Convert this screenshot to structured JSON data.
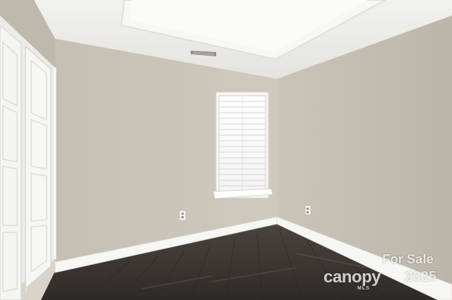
{
  "watermark": {
    "line1": "For Sale",
    "brand": "canopy",
    "sub": "MLS",
    "year": "2025"
  },
  "colors": {
    "wall_left": "#c9c2b6",
    "wall_right": "#c2bbb0",
    "ceiling": "#eeedea",
    "floor": "#3a3532",
    "trim": "#f6f6f4"
  }
}
